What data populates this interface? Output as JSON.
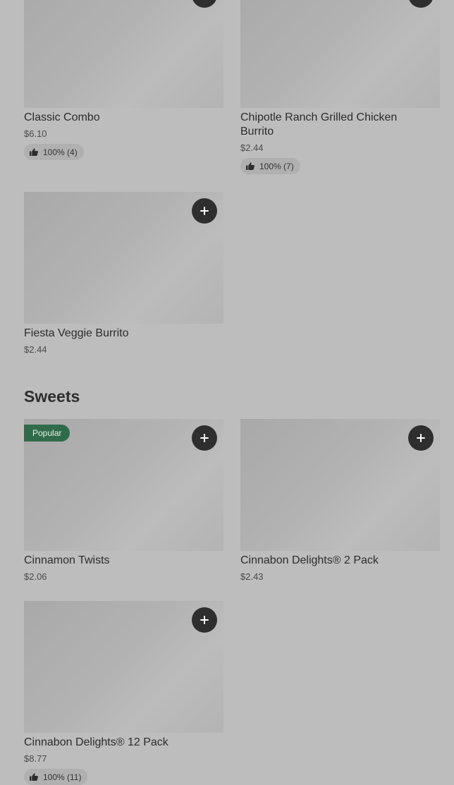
{
  "sections": [
    {
      "title": "",
      "items": [
        {
          "name": "Classic Combo",
          "price": "$6.10",
          "rating": "100% (4)"
        },
        {
          "name": "Chipotle Ranch Grilled Chicken Burrito",
          "price": "$2.44",
          "rating": "100% (7)"
        },
        {
          "name": "Fiesta Veggie Burrito",
          "price": "$2.44",
          "rating": ""
        }
      ]
    },
    {
      "title": "Sweets",
      "items": [
        {
          "name": "Cinnamon Twists",
          "price": "$2.06",
          "badge": "Popular"
        },
        {
          "name": "Cinnabon Delights® 2 Pack",
          "price": "$2.43"
        },
        {
          "name": "Cinnabon Delights® 12 Pack",
          "price": "$8.77",
          "rating": "100% (11)"
        }
      ]
    }
  ],
  "icons": {
    "add": "plus-icon",
    "rating": "thumbs-up-icon"
  },
  "colors": {
    "background": "#bdbdbd",
    "add_button": "#2e2e2e",
    "popular_badge": "#2f6b4a"
  }
}
